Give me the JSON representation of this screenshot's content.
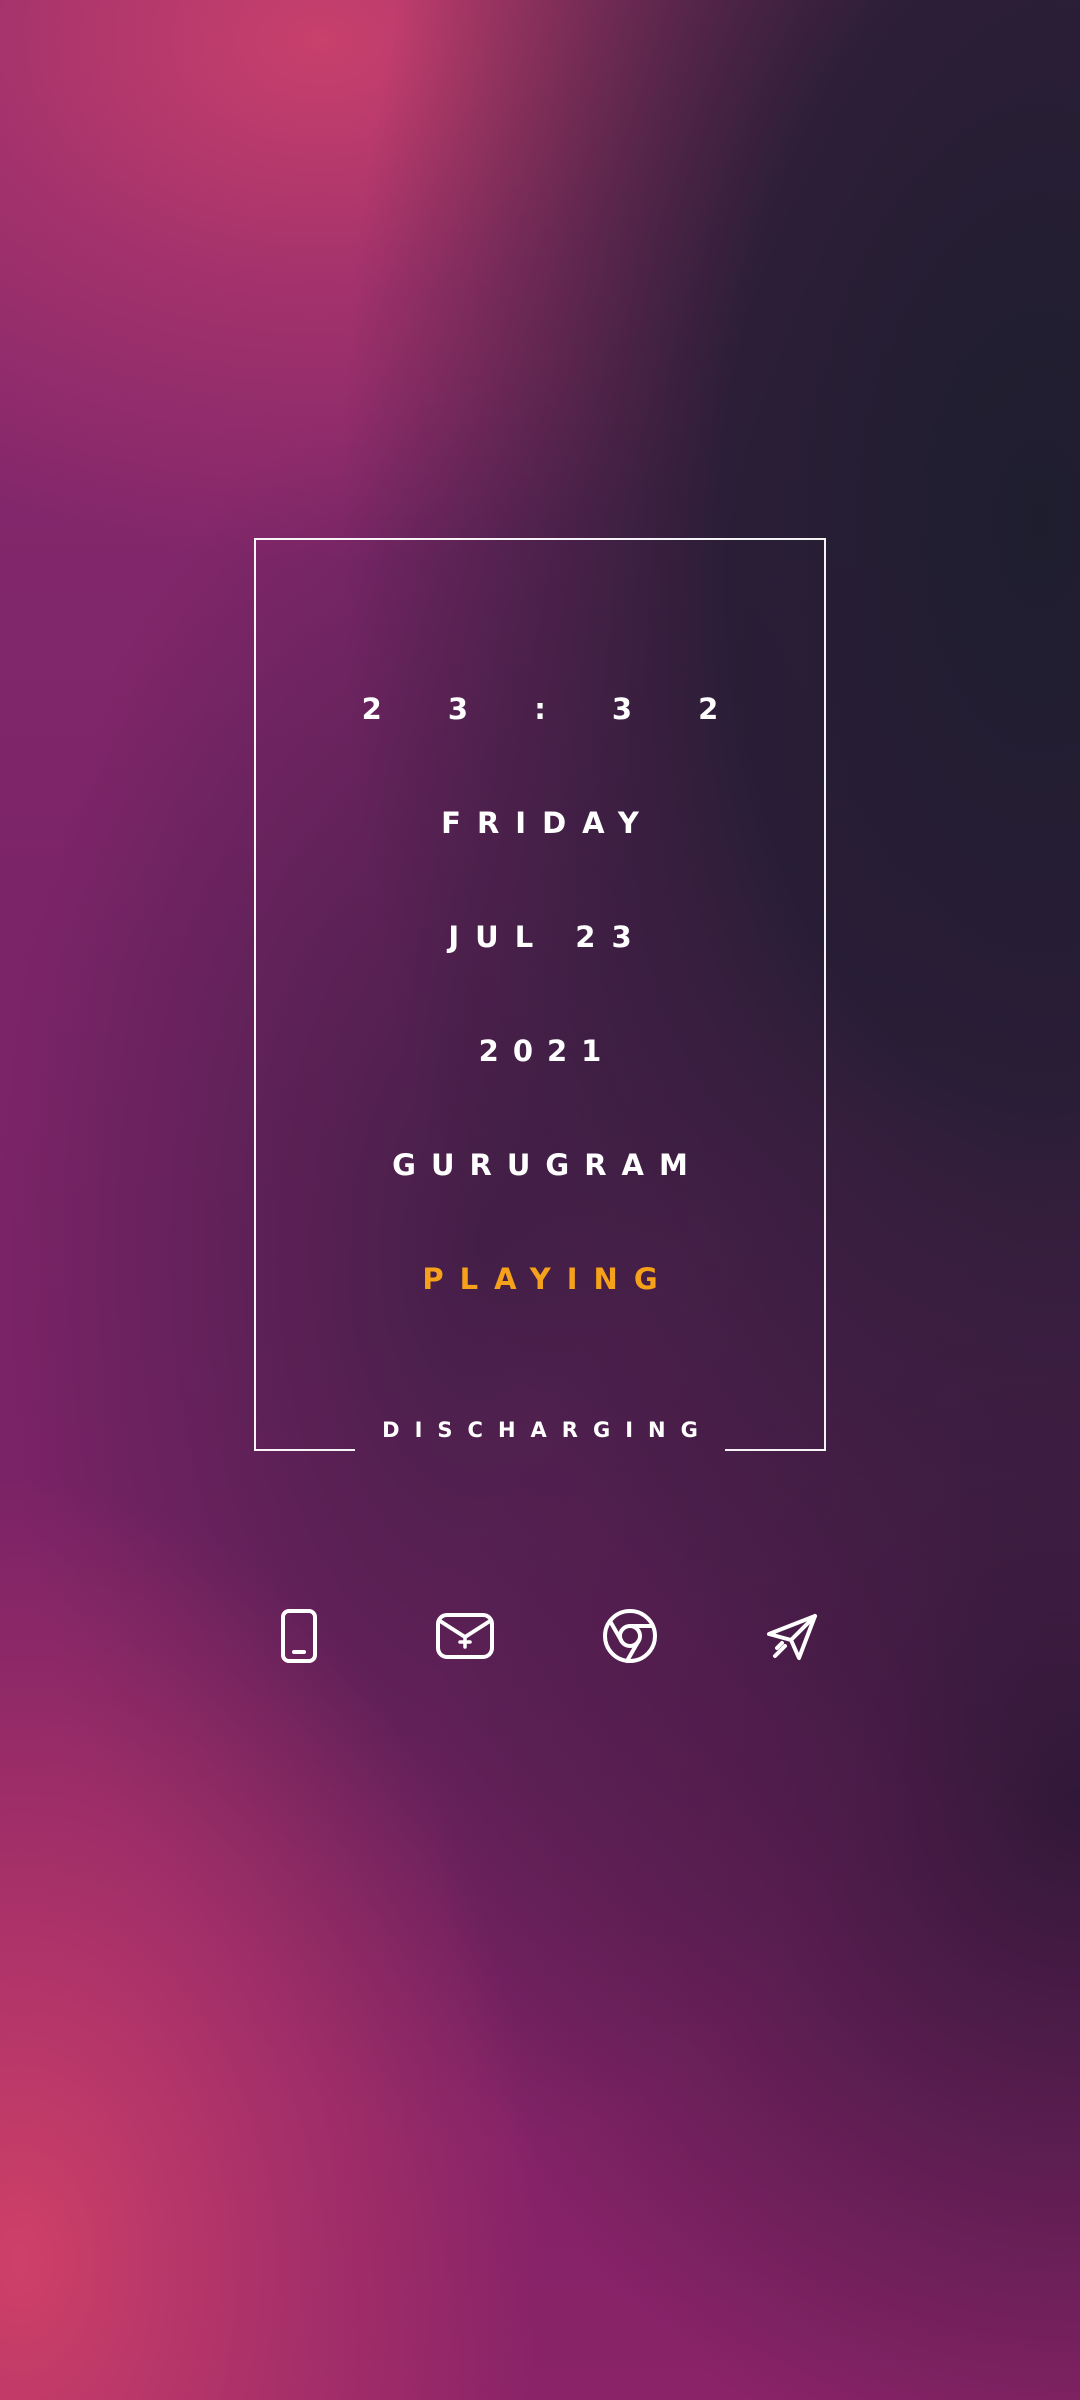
{
  "clock": {
    "time": "2 3 : 3 2",
    "day": "FRIDAY",
    "date": "JUL 23",
    "year": "2021",
    "location": "GURUGRAM",
    "media_status": "PLAYING",
    "battery_status": "DISCHARGING"
  },
  "colors": {
    "accent": "#f5a11a",
    "text": "#ffffff",
    "wallpaper_pink": "#c8406c",
    "wallpaper_purple": "#7b2468",
    "wallpaper_dark": "#1c1d2c"
  },
  "dock": {
    "apps": [
      {
        "icon": "phone-icon"
      },
      {
        "icon": "mail-icon"
      },
      {
        "icon": "chrome-icon"
      },
      {
        "icon": "send-icon"
      }
    ]
  }
}
